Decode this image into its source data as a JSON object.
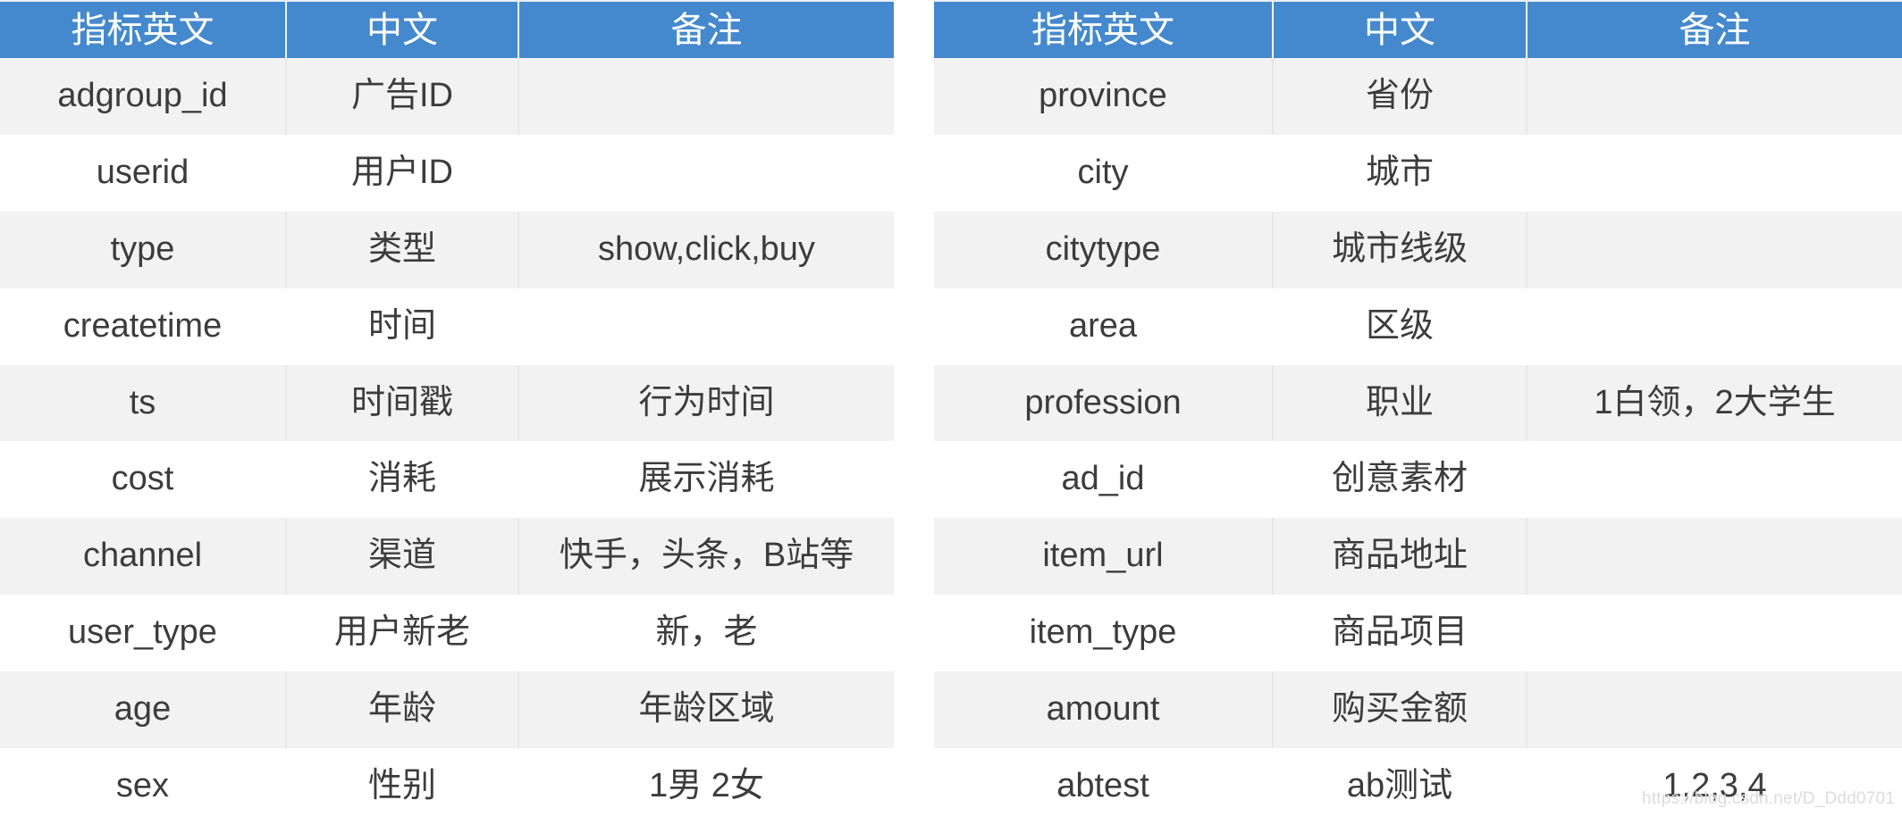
{
  "colors": {
    "header_blue": "#4489ce",
    "row_stripe": "#f2f2f2",
    "row_plain": "#ffffff",
    "text": "#3c3c3c",
    "watermark": "#dcdcdc"
  },
  "watermark": "https://blog.csdn.net/D_Ddd0701",
  "tables": [
    {
      "id": "left-table",
      "headers": [
        "指标英文",
        "中文",
        "备注"
      ],
      "rows": [
        {
          "en": "adgroup_id",
          "cn": "广告ID",
          "note": ""
        },
        {
          "en": "userid",
          "cn": "用户ID",
          "note": ""
        },
        {
          "en": "type",
          "cn": "类型",
          "note": "show,click,buy"
        },
        {
          "en": "createtime",
          "cn": "时间",
          "note": ""
        },
        {
          "en": "ts",
          "cn": "时间戳",
          "note": "行为时间"
        },
        {
          "en": "cost",
          "cn": "消耗",
          "note": "展示消耗"
        },
        {
          "en": "channel",
          "cn": "渠道",
          "note": "快手，头条，B站等"
        },
        {
          "en": "user_type",
          "cn": "用户新老",
          "note": "新，老"
        },
        {
          "en": "age",
          "cn": "年龄",
          "note": "年龄区域"
        },
        {
          "en": "sex",
          "cn": "性别",
          "note": "1男 2女"
        }
      ]
    },
    {
      "id": "right-table",
      "headers": [
        "指标英文",
        "中文",
        "备注"
      ],
      "rows": [
        {
          "en": "province",
          "cn": "省份",
          "note": ""
        },
        {
          "en": "city",
          "cn": "城市",
          "note": ""
        },
        {
          "en": "citytype",
          "cn": "城市线级",
          "note": ""
        },
        {
          "en": "area",
          "cn": "区级",
          "note": ""
        },
        {
          "en": "profession",
          "cn": "职业",
          "note": "1白领，2大学生"
        },
        {
          "en": "ad_id",
          "cn": "创意素材",
          "note": ""
        },
        {
          "en": "item_url",
          "cn": "商品地址",
          "note": ""
        },
        {
          "en": "item_type",
          "cn": "商品项目",
          "note": ""
        },
        {
          "en": "amount",
          "cn": "购买金额",
          "note": ""
        },
        {
          "en": "abtest",
          "cn": "ab测试",
          "note": "1,2,3,4"
        }
      ]
    }
  ]
}
